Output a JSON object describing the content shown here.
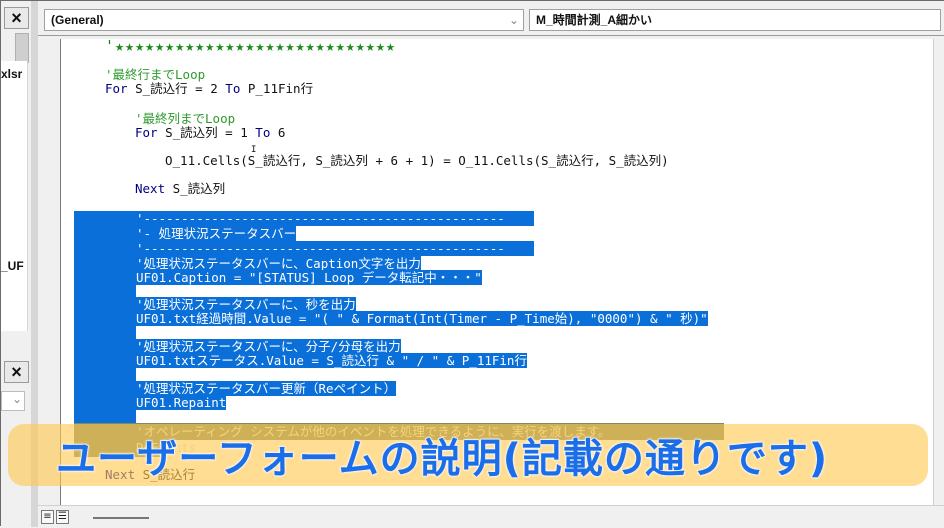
{
  "left_pane": {
    "close_label": "×",
    "tree_items": [
      {
        "label": "xlsr"
      },
      {
        "label": "_UF"
      }
    ],
    "lower_close_label": "×",
    "combo_chevron": "⌄"
  },
  "code_window": {
    "object_combo": {
      "value": "(General)",
      "chevron": "⌄"
    },
    "procedure_combo": {
      "value": "M_時間計測_A細かい"
    },
    "lines": {
      "stars": "'★★★★★★★★★★★★★★★★★★★★★★★★★★★★",
      "c_last_row": "'最終行までLoop",
      "for_row_kw": "For",
      "for_row_a": " S_読込行 = 2 ",
      "for_row_kw2": "To",
      "for_row_b": " P_11Fin行",
      "c_last_col": "'最終列までLoop",
      "for_col_kw": "For",
      "for_col_a": " S_読込列 = 1 ",
      "for_col_kw2": "To",
      "for_col_b": " 6",
      "assign": "O_11.Cells(S_読込行, S_読込列 + 6 + 1) = O_11.Cells(S_読込行, S_読込列)",
      "next_col_kw": "Next",
      "next_col_b": " S_読込列",
      "sep1": "'------------------------------------------------",
      "section": "'- 処理状況ステータスバー",
      "sep2": "'------------------------------------------------",
      "c_caption": "'処理状況ステータスバーに、Caption文字を出力",
      "caption_stmt": "UF01.Caption = \"[STATUS] Loop データ転記中・・・\"",
      "c_seconds": "'処理状況ステータスバーに、秒を出力",
      "seconds_stmt": "UF01.txt経過時間.Value = \"( \" & Format(Int(Timer - P_Time始), \"0000\") & \" 秒)\"",
      "c_ratio": "'処理状況ステータスバーに、分子/分母を出力",
      "ratio_stmt": "UF01.txtステータス.Value = S_読込行 & \" / \" & P_11Fin行",
      "c_repaint": "'処理状況ステータスバー更新（Reペイント）",
      "repaint_stmt": "UF01.Repaint",
      "c_doevents": "'オペレーティング システムが他のイベントを処理できるように、実行を渡します。",
      "doevents_stmt": "DoEvents",
      "next_row_kw": "Next",
      "next_row_b": " S_読込行"
    },
    "cursor_glyph": "I",
    "view_buttons": {
      "procedure_view": "≡",
      "full_module_view": "☰"
    }
  },
  "caption_overlay": {
    "text": "ユーザーフォームの説明(記載の通りです)"
  }
}
